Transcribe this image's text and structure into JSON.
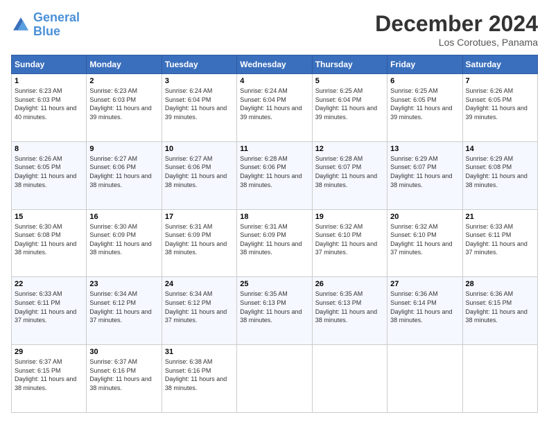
{
  "header": {
    "logo_line1": "General",
    "logo_line2": "Blue",
    "month_title": "December 2024",
    "location": "Los Corotues, Panama"
  },
  "days_of_week": [
    "Sunday",
    "Monday",
    "Tuesday",
    "Wednesday",
    "Thursday",
    "Friday",
    "Saturday"
  ],
  "weeks": [
    [
      {
        "day": "1",
        "sunrise": "6:23 AM",
        "sunset": "6:03 PM",
        "daylight": "11 hours and 40 minutes."
      },
      {
        "day": "2",
        "sunrise": "6:23 AM",
        "sunset": "6:03 PM",
        "daylight": "11 hours and 39 minutes."
      },
      {
        "day": "3",
        "sunrise": "6:24 AM",
        "sunset": "6:04 PM",
        "daylight": "11 hours and 39 minutes."
      },
      {
        "day": "4",
        "sunrise": "6:24 AM",
        "sunset": "6:04 PM",
        "daylight": "11 hours and 39 minutes."
      },
      {
        "day": "5",
        "sunrise": "6:25 AM",
        "sunset": "6:04 PM",
        "daylight": "11 hours and 39 minutes."
      },
      {
        "day": "6",
        "sunrise": "6:25 AM",
        "sunset": "6:05 PM",
        "daylight": "11 hours and 39 minutes."
      },
      {
        "day": "7",
        "sunrise": "6:26 AM",
        "sunset": "6:05 PM",
        "daylight": "11 hours and 39 minutes."
      }
    ],
    [
      {
        "day": "8",
        "sunrise": "6:26 AM",
        "sunset": "6:05 PM",
        "daylight": "11 hours and 38 minutes."
      },
      {
        "day": "9",
        "sunrise": "6:27 AM",
        "sunset": "6:06 PM",
        "daylight": "11 hours and 38 minutes."
      },
      {
        "day": "10",
        "sunrise": "6:27 AM",
        "sunset": "6:06 PM",
        "daylight": "11 hours and 38 minutes."
      },
      {
        "day": "11",
        "sunrise": "6:28 AM",
        "sunset": "6:06 PM",
        "daylight": "11 hours and 38 minutes."
      },
      {
        "day": "12",
        "sunrise": "6:28 AM",
        "sunset": "6:07 PM",
        "daylight": "11 hours and 38 minutes."
      },
      {
        "day": "13",
        "sunrise": "6:29 AM",
        "sunset": "6:07 PM",
        "daylight": "11 hours and 38 minutes."
      },
      {
        "day": "14",
        "sunrise": "6:29 AM",
        "sunset": "6:08 PM",
        "daylight": "11 hours and 38 minutes."
      }
    ],
    [
      {
        "day": "15",
        "sunrise": "6:30 AM",
        "sunset": "6:08 PM",
        "daylight": "11 hours and 38 minutes."
      },
      {
        "day": "16",
        "sunrise": "6:30 AM",
        "sunset": "6:09 PM",
        "daylight": "11 hours and 38 minutes."
      },
      {
        "day": "17",
        "sunrise": "6:31 AM",
        "sunset": "6:09 PM",
        "daylight": "11 hours and 38 minutes."
      },
      {
        "day": "18",
        "sunrise": "6:31 AM",
        "sunset": "6:09 PM",
        "daylight": "11 hours and 38 minutes."
      },
      {
        "day": "19",
        "sunrise": "6:32 AM",
        "sunset": "6:10 PM",
        "daylight": "11 hours and 37 minutes."
      },
      {
        "day": "20",
        "sunrise": "6:32 AM",
        "sunset": "6:10 PM",
        "daylight": "11 hours and 37 minutes."
      },
      {
        "day": "21",
        "sunrise": "6:33 AM",
        "sunset": "6:11 PM",
        "daylight": "11 hours and 37 minutes."
      }
    ],
    [
      {
        "day": "22",
        "sunrise": "6:33 AM",
        "sunset": "6:11 PM",
        "daylight": "11 hours and 37 minutes."
      },
      {
        "day": "23",
        "sunrise": "6:34 AM",
        "sunset": "6:12 PM",
        "daylight": "11 hours and 37 minutes."
      },
      {
        "day": "24",
        "sunrise": "6:34 AM",
        "sunset": "6:12 PM",
        "daylight": "11 hours and 37 minutes."
      },
      {
        "day": "25",
        "sunrise": "6:35 AM",
        "sunset": "6:13 PM",
        "daylight": "11 hours and 38 minutes."
      },
      {
        "day": "26",
        "sunrise": "6:35 AM",
        "sunset": "6:13 PM",
        "daylight": "11 hours and 38 minutes."
      },
      {
        "day": "27",
        "sunrise": "6:36 AM",
        "sunset": "6:14 PM",
        "daylight": "11 hours and 38 minutes."
      },
      {
        "day": "28",
        "sunrise": "6:36 AM",
        "sunset": "6:15 PM",
        "daylight": "11 hours and 38 minutes."
      }
    ],
    [
      {
        "day": "29",
        "sunrise": "6:37 AM",
        "sunset": "6:15 PM",
        "daylight": "11 hours and 38 minutes."
      },
      {
        "day": "30",
        "sunrise": "6:37 AM",
        "sunset": "6:16 PM",
        "daylight": "11 hours and 38 minutes."
      },
      {
        "day": "31",
        "sunrise": "6:38 AM",
        "sunset": "6:16 PM",
        "daylight": "11 hours and 38 minutes."
      },
      null,
      null,
      null,
      null
    ]
  ]
}
